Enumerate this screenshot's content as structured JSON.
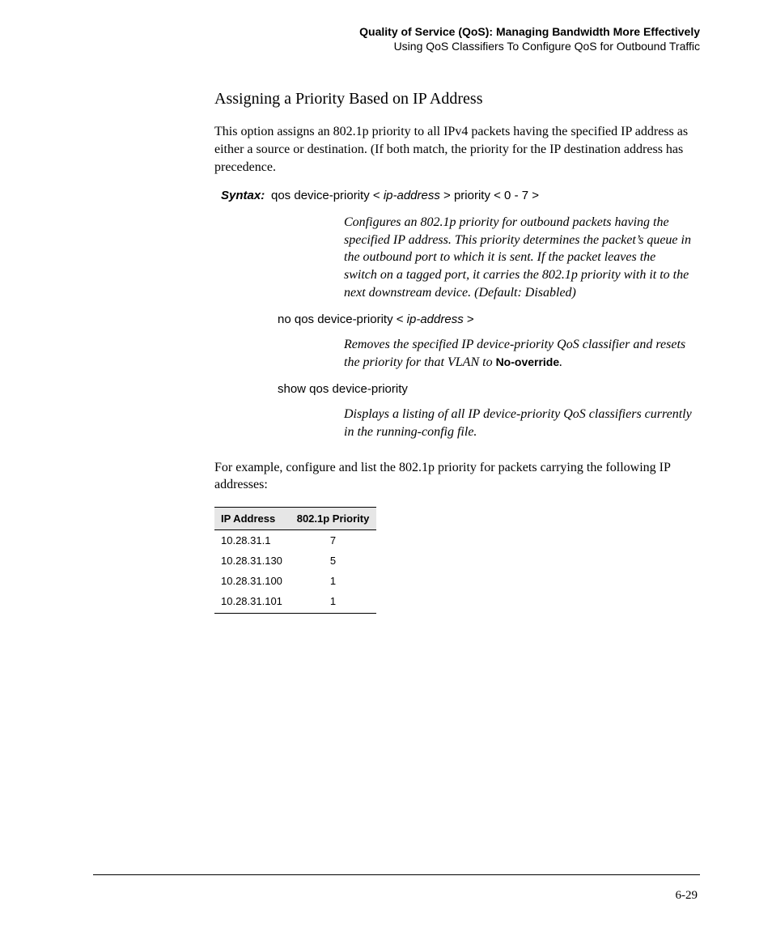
{
  "header": {
    "title": "Quality of Service (QoS): Managing Bandwidth More Effectively",
    "subtitle": "Using QoS Classifiers To Configure QoS for Outbound Traffic"
  },
  "section": {
    "heading": "Assigning a Priority Based on IP Address",
    "intro": "This option assigns an 802.1p priority to all IPv4 packets having the specified IP address as either a source or destination. (If both match, the priority for the IP destination address has precedence."
  },
  "syntax": {
    "label": "Syntax:",
    "cmd_pre": "qos device-priority < ",
    "cmd_param": "ip-address",
    "cmd_mid": " > priority < 0 - 7 >",
    "desc1": "Configures an 802.1p priority for outbound packets having the specified IP address. This priority determines the packet’s queue in the outbound port to which it is sent. If the packet leaves the switch on a tagged port, it carries the 802.1p priority with it to the next downstream device. (Default: Disabled)",
    "no_cmd_pre": "no qos device-priority < ",
    "no_cmd_param": "ip-address",
    "no_cmd_post": " >",
    "desc2_a": "Removes the specified IP device-priority QoS classifier and resets the priority for that VLAN to ",
    "desc2_bold": "No-override",
    "desc2_b": ".",
    "show_cmd": "show qos device-priority",
    "desc3": "Displays a listing of all IP device-priority QoS classifiers currently in the running-config file."
  },
  "example": {
    "intro": "For example, configure and list the 802.1p priority for packets carrying the following IP addresses:"
  },
  "table": {
    "headers": {
      "ip": "IP Address",
      "prio": "802.1p Priority"
    },
    "rows": [
      {
        "ip": "10.28.31.1",
        "prio": "7"
      },
      {
        "ip": "10.28.31.130",
        "prio": "5"
      },
      {
        "ip": "10.28.31.100",
        "prio": "1"
      },
      {
        "ip": "10.28.31.101",
        "prio": "1"
      }
    ]
  },
  "page_number": "6-29"
}
